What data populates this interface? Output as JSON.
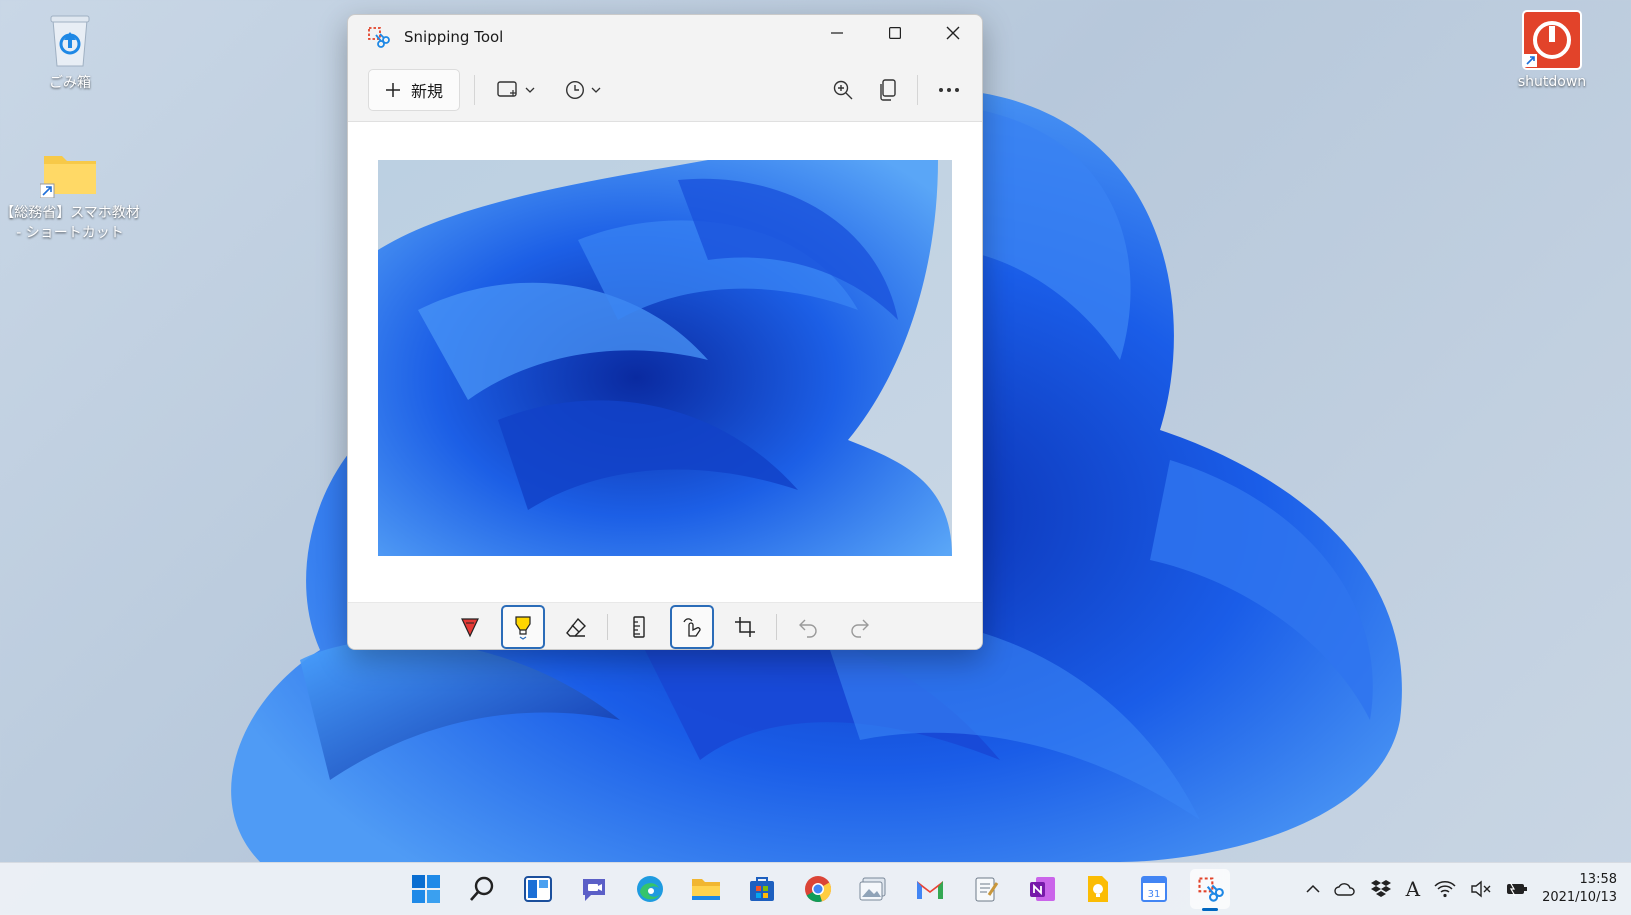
{
  "desktop": {
    "icons": [
      {
        "label": "ごみ箱"
      },
      {
        "label_line1": "【総務省】スマホ教材",
        "label_line2": "- ショートカット"
      },
      {
        "label": "shutdown"
      }
    ]
  },
  "window": {
    "title": "Snipping Tool",
    "toolbar": {
      "new_label": "新規"
    }
  },
  "taskbar": {
    "apps": [
      "start-icon",
      "search-icon",
      "widgets-icon",
      "chat-icon",
      "edge-icon",
      "file-explorer-icon",
      "store-icon",
      "chrome-icon",
      "photos-icon",
      "gmail-icon",
      "notepad-icon",
      "onenote-icon",
      "keep-icon",
      "calendar-icon",
      "snipping-tool-icon"
    ],
    "calendar_day": "31",
    "ime_label": "A",
    "clock": {
      "time": "13:58",
      "date": "2021/10/13"
    }
  },
  "colors": {
    "accent": "#0067c0",
    "shutdown_red": "#e2432a",
    "wallpaper_blue": "#1f5ee8"
  }
}
